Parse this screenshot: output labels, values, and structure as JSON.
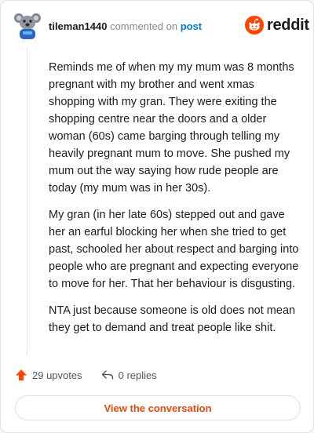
{
  "header": {
    "username": "tileman1440",
    "action": "commented on",
    "post_link": "post",
    "brand": "reddit"
  },
  "comment": {
    "paragraphs": [
      "Reminds me of when my my mum was 8 months pregnant with my brother and went xmas shopping with my gran. They were exiting the shopping centre near the doors and a older woman (60s) came barging through telling my heavily pregnant mum to move. She pushed my mum out the way saying how rude people are today (my mum was in her 30s).",
      "My gran (in her late 60s) stepped out and gave her an earful blocking her when she tried to get past, schooled her about respect and barging into people who are pregnant and expecting everyone to move for her. That her behaviour is disgusting.",
      "NTA just because someone is old does not mean they get to demand and treat people like shit."
    ]
  },
  "footer": {
    "upvotes": "29 upvotes",
    "replies": "0 replies",
    "view_button": "View the conversation"
  },
  "colors": {
    "brand_orange": "#ff4500",
    "link_blue": "#0079d3",
    "button_text": "#e44a0c"
  },
  "icons": {
    "avatar": "avatar-koala",
    "logo": "reddit-snoo-icon",
    "upvote": "upvote-arrow-icon",
    "reply": "reply-arrow-icon"
  }
}
